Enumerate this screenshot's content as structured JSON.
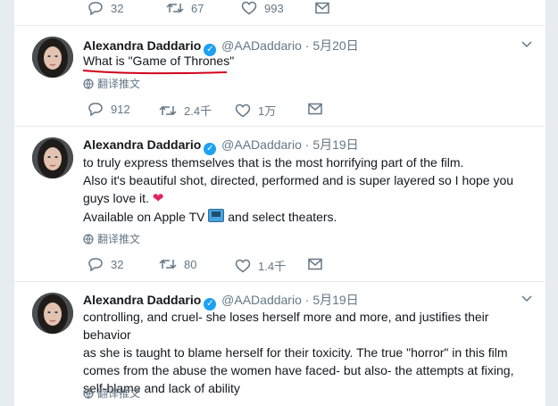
{
  "top_actions": {
    "reply": "32",
    "retweet": "67",
    "like": "993"
  },
  "tweets": [
    {
      "name": "Alexandra Daddario",
      "handle": "@AADaddario",
      "dot": "·",
      "time": "5月20日",
      "lines": [
        "What is \"Game of Thrones\""
      ],
      "translate": "翻译推文",
      "reply": "912",
      "retweet": "2.4千",
      "like": "1万"
    },
    {
      "name": "Alexandra Daddario",
      "handle": "@AADaddario",
      "dot": "·",
      "time": "5月19日",
      "lines": [
        "to truly express themselves that is the most horrifying part of the film.",
        "Also it's beautiful shot, directed, performed and is super layered so I hope you",
        "guys love it.",
        "Available on Apple TV",
        "and select theaters."
      ],
      "translate": "翻译推文",
      "reply": "32",
      "retweet": "80",
      "like": "1.4千"
    },
    {
      "name": "Alexandra Daddario",
      "handle": "@AADaddario",
      "dot": "·",
      "time": "5月19日",
      "lines": [
        "controlling, and cruel- she loses herself more and more, and justifies their behavior",
        "as she is taught to blame herself for their toxicity. The true \"horror\" in this film",
        "comes from the abuse the women have faced- but also- the attempts at fixing,",
        "self-blame and lack of ability"
      ],
      "translate": "翻译推文"
    }
  ],
  "colors": {
    "accent": "#1da1f2",
    "annotation": "#d0021b",
    "heart": "#e0245e"
  }
}
